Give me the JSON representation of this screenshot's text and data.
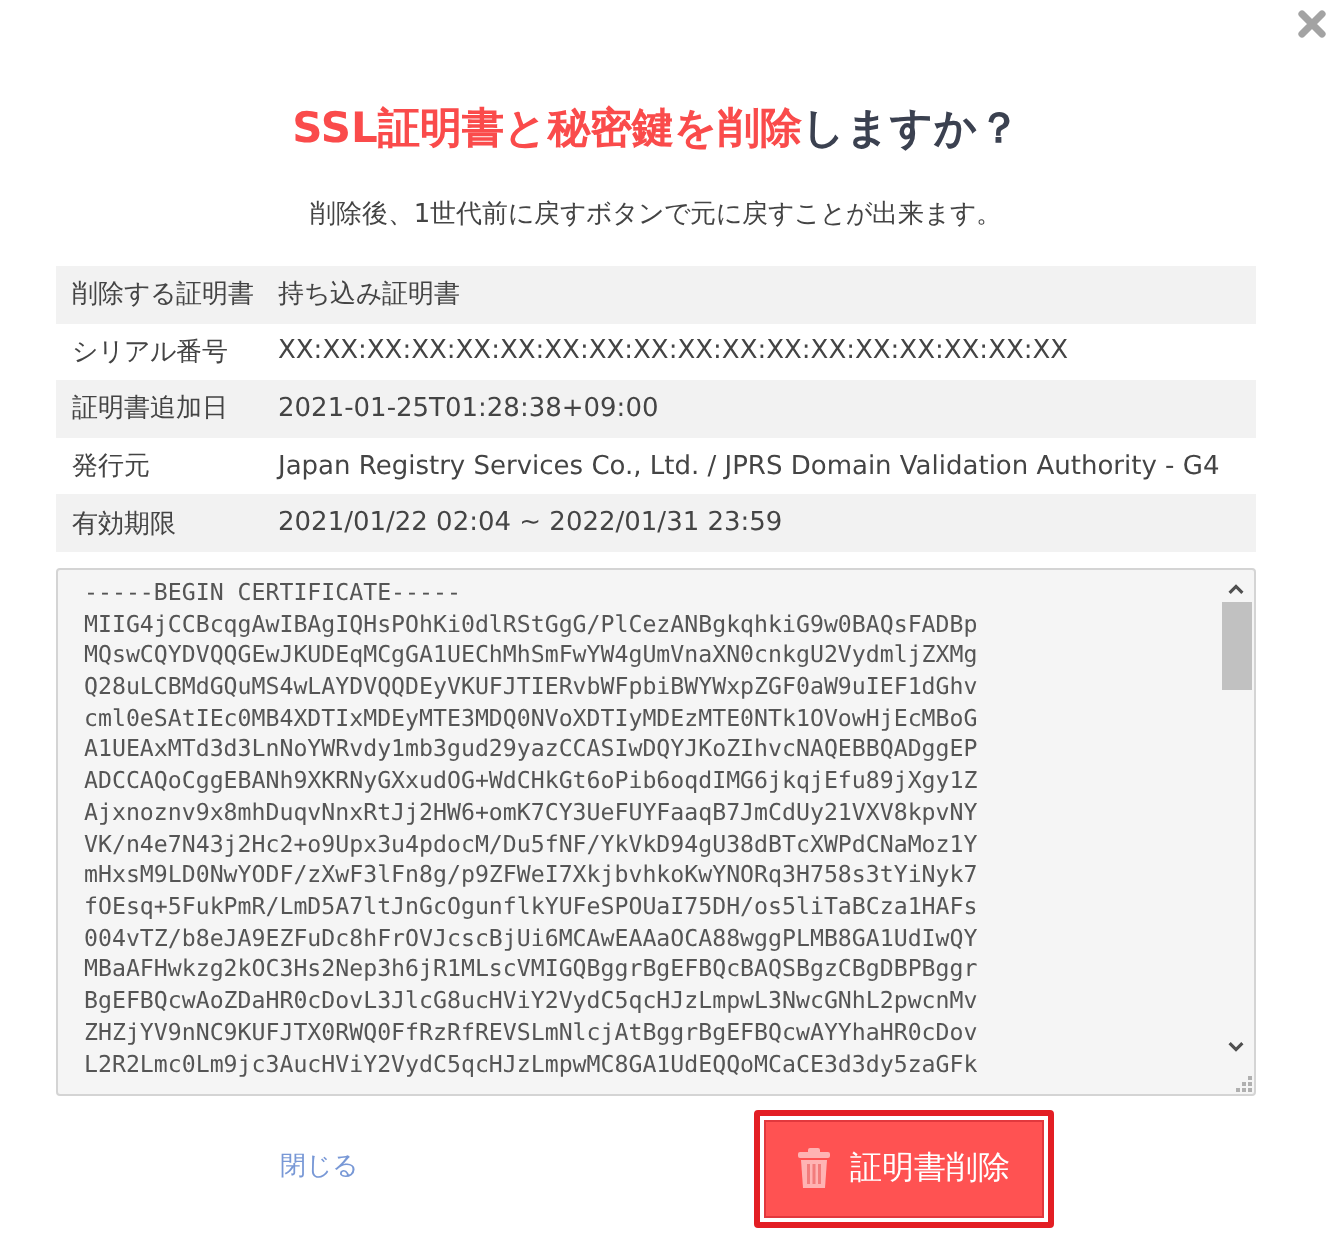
{
  "title": {
    "highlight": "SSL証明書と秘密鍵を削除",
    "text": "しますか？"
  },
  "message": "削除後、1世代前に戻すボタンで元に戻すことが出来ます。",
  "details": [
    {
      "label": "削除する証明書",
      "value": "持ち込み証明書"
    },
    {
      "label": "シリアル番号",
      "value": "XX:XX:XX:XX:XX:XX:XX:XX:XX:XX:XX:XX:XX:XX:XX:XX:XX:XX"
    },
    {
      "label": "証明書追加日",
      "value": "2021-01-25T01:28:38+09:00"
    },
    {
      "label": "発行元",
      "value": "Japan Registry Services Co., Ltd. / JPRS Domain Validation Authority - G4"
    },
    {
      "label": "有効期限",
      "value": "2021/01/22 02:04 ~ 2022/01/31 23:59"
    }
  ],
  "certificate": {
    "lines": [
      "-----BEGIN CERTIFICATE-----",
      "MIIG4jCCBcqgAwIBAgIQHsPOhKi0dlRStGgG/PlCezANBgkqhkiG9w0BAQsFADBp",
      "MQswCQYDVQQGEwJKUDEqMCgGA1UEChMhSmFwYW4gUmVnaXN0cnkgU2VydmljZXMg",
      "Q28uLCBMdGQuMS4wLAYDVQQDEyVKUFJTIERvbWFpbiBWYWxpZGF0aW9uIEF1dGhv",
      "cml0eSAtIEc0MB4XDTIxMDEyMTE3MDQ0NVoXDTIyMDEzMTE0NTk1OVowHjEcMBoG",
      "A1UEAxMTd3d3LnNoYWRvdy1mb3gud29yazCCASIwDQYJKoZIhvcNAQEBBQADggEP",
      "ADCCAQoCggEBANh9XKRNyGXxudOG+WdCHkGt6oPib6oqdIMG6jkqjEfu89jXgy1Z",
      "Ajxnoznv9x8mhDuqvNnxRtJj2HW6+omK7CY3UeFUYFaaqB7JmCdUy21VXV8kpvNY",
      "VK/n4e7N43j2Hc2+o9Upx3u4pdocM/Du5fNF/YkVkD94gU38dBTcXWPdCNaMoz1Y",
      "mHxsM9LD0NwYODF/zXwF3lFn8g/p9ZFWeI7XkjbvhkoKwYNORq3H758s3tYiNyk7",
      "fOEsq+5FukPmR/LmD5A7ltJnGcOgunflkYUFeSPOUaI75DH/os5liTaBCza1HAFs",
      "004vTZ/b8eJA9EZFuDc8hFrOVJcscBjUi6MCAwEAAaOCA88wggPLMB8GA1UdIwQY",
      "MBaAFHwkzg2kOC3Hs2Nep3h6jR1MLscVMIGQBggrBgEFBQcBAQSBgzCBgDBPBggr",
      "BgEFBQcwAoZDaHR0cDovL3JlcG8ucHViY2VydC5qcHJzLmpwL3NwcGNhL2pwcnMv",
      "ZHZjYV9nNC9KUFJTX0RWQ0FfRzRfREVSLmNlcjAtBggrBgEFBQcwAYYhaHR0cDov",
      "L2R2Lmc0Lm9jc3AucHViY2VydC5qcHJzLmpwMC8GA1UdEQQoMCaCE3d3dy5zaGFk"
    ]
  },
  "buttons": [
    {
      "kind": "link",
      "label": "閉じる",
      "focused": false
    },
    {
      "kind": "danger",
      "label": "証明書削除",
      "focused": true
    }
  ]
}
